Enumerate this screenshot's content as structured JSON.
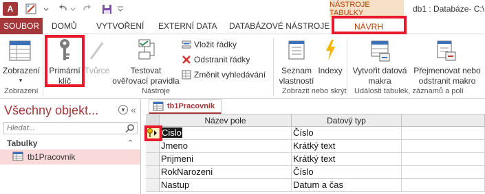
{
  "app": {
    "logo_text": "A",
    "window_title": "db1 : Databáze- C:\\",
    "context_tools_label": "NÁSTROJE TABULKY"
  },
  "tabs": {
    "file": "SOUBOR",
    "items": [
      "DOMŮ",
      "VYTVOŘENÍ",
      "EXTERNÍ DATA",
      "DATABÁZOVÉ NÁSTROJE"
    ],
    "design": "NÁVRH"
  },
  "ribbon": {
    "views": {
      "label": "Zobrazení",
      "group": "Zobrazení"
    },
    "primary_key": {
      "line1": "Primární",
      "line2": "klíč"
    },
    "builder": {
      "label": "Tvůrce"
    },
    "test_rules": {
      "line1": "Testovat",
      "line2": "ověřovací pravidla"
    },
    "insert_rows": "Vložit řádky",
    "delete_rows": "Odstranit řádky",
    "modify_lookups": "Změnit vyhledávání",
    "tools_group": "Nástroje",
    "property_sheet": {
      "line1": "Seznam",
      "line2": "vlastností"
    },
    "indexes": "Indexy",
    "show_hide_group": "Zobrazit nebo skrýt",
    "create_macro": {
      "line1": "Vytvořit datová",
      "line2": "makra"
    },
    "rename_macro": {
      "line1": "Přejmenovat nebo",
      "line2": "odstranit makro"
    },
    "events_group": "Události tabulek, záznamů a polí"
  },
  "nav": {
    "title": "Všechny objekt...",
    "search_placeholder": "Hledat...",
    "section": "Tabulky",
    "items": [
      "tb1Pracovnik"
    ]
  },
  "document": {
    "tab_label": "tb1Pracovnik",
    "columns": [
      "Název pole",
      "Datový typ"
    ],
    "rows": [
      {
        "field": "Cislo",
        "type": "Číslo"
      },
      {
        "field": "Jmeno",
        "type": "Krátký text"
      },
      {
        "field": "Prijmeni",
        "type": "Krátký text"
      },
      {
        "field": "RokNarozeni",
        "type": "Číslo"
      },
      {
        "field": "Nastup",
        "type": "Datum a čas"
      }
    ]
  },
  "colors": {
    "accent": "#a4373a",
    "highlight": "#e8192c",
    "context": "#f6e0c8"
  }
}
